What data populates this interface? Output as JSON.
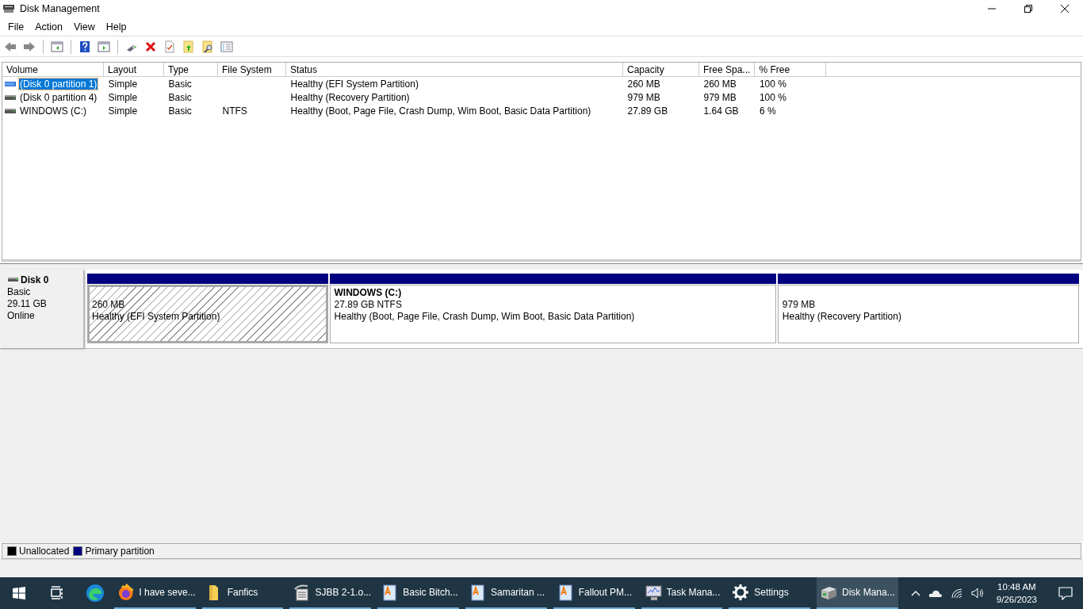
{
  "window": {
    "title": "Disk Management"
  },
  "menu": [
    {
      "label": "File"
    },
    {
      "label": "Action"
    },
    {
      "label": "View"
    },
    {
      "label": "Help"
    }
  ],
  "table": {
    "columns": [
      "Volume",
      "Layout",
      "Type",
      "File System",
      "Status",
      "Capacity",
      "Free Spa...",
      "% Free"
    ],
    "rows": [
      {
        "cells": [
          "(Disk 0 partition 1)",
          "Simple",
          "Basic",
          "",
          "Healthy (EFI System Partition)",
          "260 MB",
          "260 MB",
          "100 %"
        ],
        "selected": true
      },
      {
        "cells": [
          "(Disk 0 partition 4)",
          "Simple",
          "Basic",
          "",
          "Healthy (Recovery Partition)",
          "979 MB",
          "979 MB",
          "100 %"
        ],
        "selected": false
      },
      {
        "cells": [
          "WINDOWS (C:)",
          "Simple",
          "Basic",
          "NTFS",
          "Healthy (Boot, Page File, Crash Dump, Wim Boot, Basic Data Partition)",
          "27.89 GB",
          "1.64 GB",
          "6 %"
        ],
        "selected": false
      }
    ]
  },
  "disk": {
    "name": "Disk 0",
    "type": "Basic",
    "size": "29.11 GB",
    "status": "Online",
    "partitions": [
      {
        "size": "260 MB",
        "status": "Healthy (EFI System Partition)",
        "selected": true,
        "color": "#000080"
      },
      {
        "title": "WINDOWS  (C:)",
        "size": "27.89 GB NTFS",
        "status": "Healthy (Boot, Page File, Crash Dump, Wim Boot, Basic Data Partition)",
        "selected": false,
        "color": "#000080"
      },
      {
        "size": "979 MB",
        "status": "Healthy (Recovery Partition)",
        "selected": false,
        "color": "#000080"
      }
    ]
  },
  "legend": [
    {
      "label": "Unallocated",
      "color": "#000000"
    },
    {
      "label": "Primary partition",
      "color": "#000080"
    }
  ],
  "taskbar": {
    "apps": [
      {
        "kind": "browser",
        "label": "I have seve...",
        "active": false
      },
      {
        "kind": "folder",
        "label": "Fanfics",
        "active": false
      },
      {
        "kind": "document",
        "label": "SJBB 2-1.o...",
        "active": false
      },
      {
        "kind": "writer",
        "label": "Basic Bitch...",
        "active": false
      },
      {
        "kind": "writer",
        "label": "Samaritan ...",
        "active": false
      },
      {
        "kind": "writer",
        "label": "Fallout PM...",
        "active": false
      },
      {
        "kind": "monitor",
        "label": "Task Mana...",
        "active": false
      },
      {
        "kind": "gear",
        "label": "Settings",
        "active": false
      },
      {
        "kind": "disk",
        "label": "Disk Mana...",
        "active": true
      }
    ],
    "time": "10:48 AM",
    "date": "9/26/2023"
  }
}
